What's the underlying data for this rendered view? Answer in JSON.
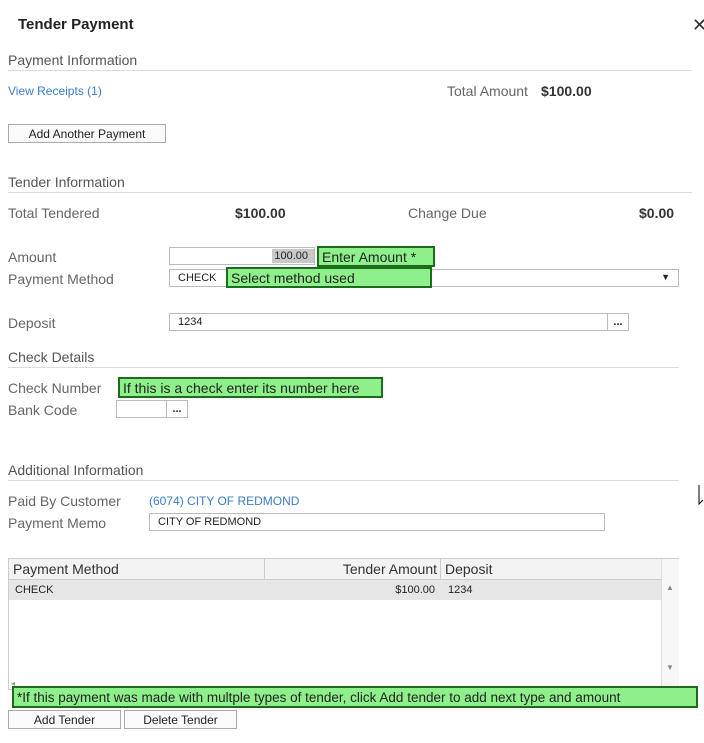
{
  "dialog": {
    "title": "Tender Payment",
    "close_glyph": "✕"
  },
  "payment_info": {
    "heading": "Payment Information",
    "view_receipts": "View Receipts (1)",
    "total_amount_label": "Total Amount",
    "total_amount_value": "$100.00",
    "add_another_payment": "Add Another Payment"
  },
  "tender_info": {
    "heading": "Tender Information",
    "total_tendered_label": "Total Tendered",
    "total_tendered_value": "$100.00",
    "change_due_label": "Change Due",
    "change_due_value": "$0.00",
    "amount_label": "Amount",
    "amount_value": "100.00",
    "amount_note": "Enter Amount *",
    "method_label": "Payment Method",
    "method_value": "CHECK",
    "method_note": "Select method used",
    "deposit_label": "Deposit",
    "deposit_value": "1234"
  },
  "check_details": {
    "heading": "Check Details",
    "check_number_label": "Check Number",
    "check_number_note": "If this is a check enter its number here",
    "bank_code_label": "Bank Code"
  },
  "additional_info": {
    "heading": "Additional Information",
    "paid_by_label": "Paid By Customer",
    "paid_by_value": "(6074) CITY OF REDMOND",
    "memo_label": "Payment Memo",
    "memo_value": "CITY OF REDMOND"
  },
  "grid": {
    "columns": [
      "Payment Method",
      "Tender Amount",
      "Deposit"
    ],
    "rows": [
      {
        "method": "CHECK",
        "amount": "$100.00",
        "deposit": "1234"
      }
    ]
  },
  "footer": {
    "tender_note": "*If this payment was made with multple types of tender, click Add tender to add next type and amount",
    "add_tender": "Add Tender",
    "delete_tender": "Delete Tender"
  },
  "icons": {
    "ellipsis": "...",
    "dropdown": "▼",
    "scroll_up": "▲",
    "scroll_down": "▼",
    "scroll_left": "◂"
  },
  "colors": {
    "link": "#3a7ec8",
    "note_fill": "#8ef08a",
    "note_border": "#1d6b1d",
    "row_selected": "#e6e6e6"
  }
}
